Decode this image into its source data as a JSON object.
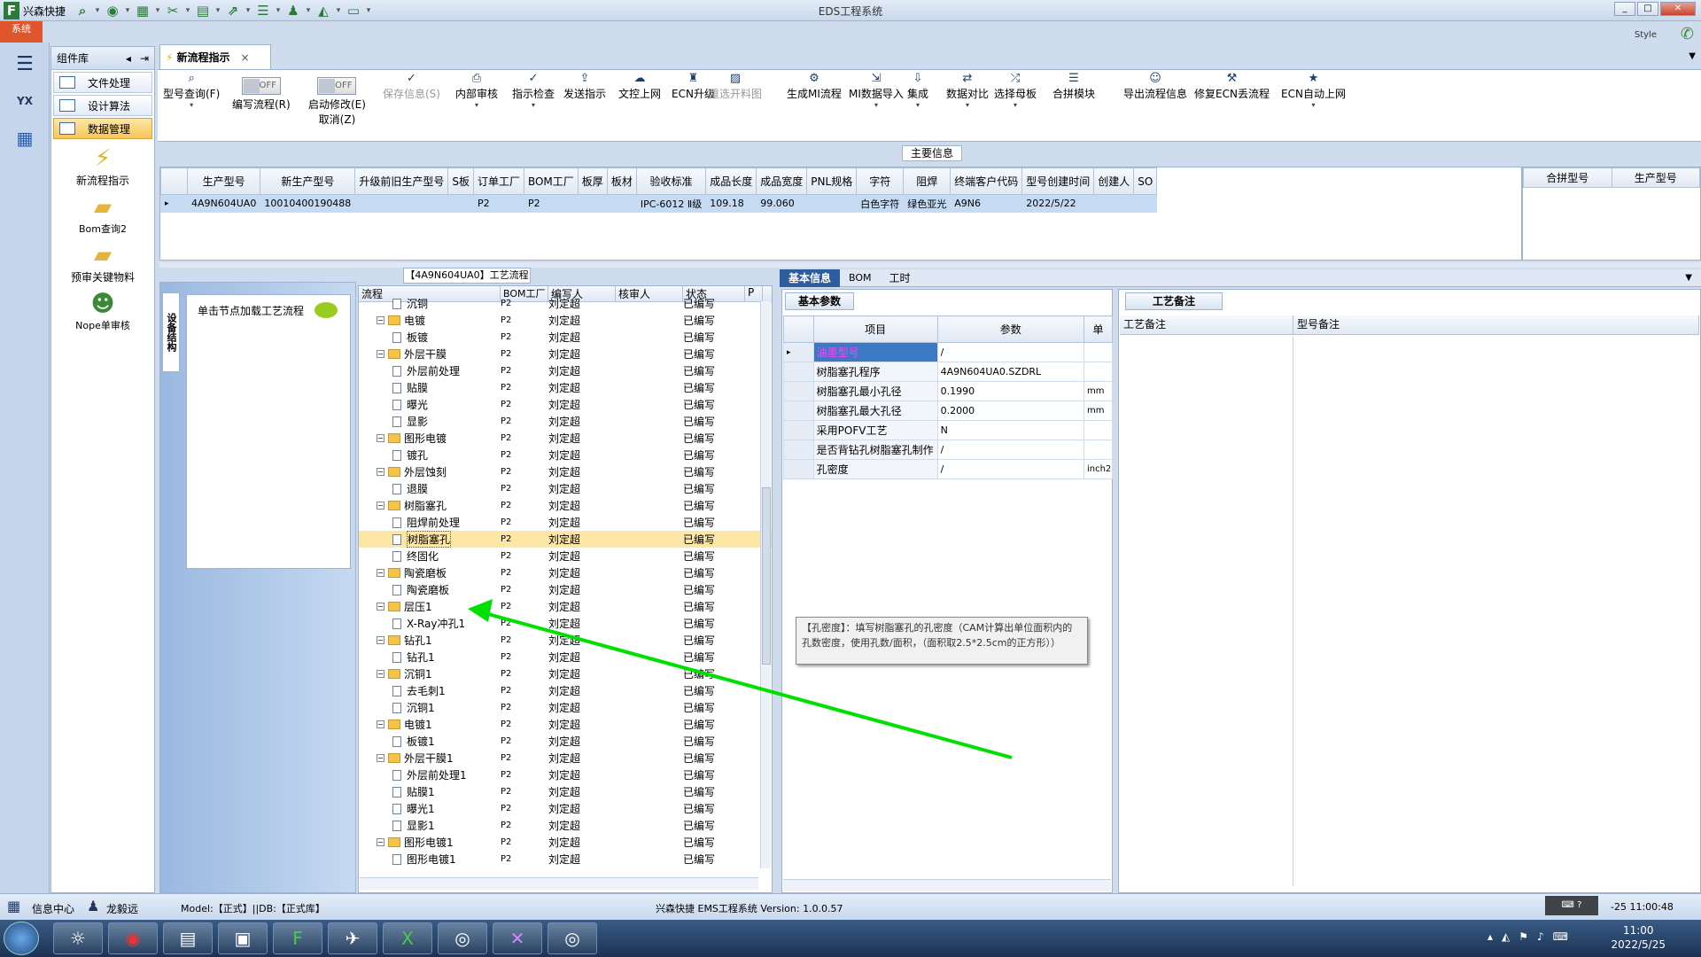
{
  "window": {
    "title": "EDS工程系统",
    "app_name": "兴森快捷",
    "system_tab": "系统",
    "style_label": "Style"
  },
  "component_panel": {
    "title": "组件库",
    "menus": [
      {
        "label": "文件处理",
        "active": false
      },
      {
        "label": "设计算法",
        "active": false
      },
      {
        "label": "数据管理",
        "active": true
      }
    ],
    "items": [
      {
        "label": "新流程指示",
        "icon": "lightning-icon"
      },
      {
        "label": "Bom查询2",
        "icon": "folder-icon"
      },
      {
        "label": "预审关键物料",
        "icon": "folder-icon"
      },
      {
        "label": "Nope单审核",
        "icon": "user-icon"
      }
    ]
  },
  "doc_tab": {
    "label": "新流程指示",
    "close": "×"
  },
  "ribbon": {
    "buttons": [
      {
        "label": "型号查询(F)",
        "icon": "search-icon",
        "disabled": false,
        "dropdown": true
      },
      {
        "label": "编写流程(R)",
        "toggle": "OFF",
        "disabled": false
      },
      {
        "label": "启动修改(E)",
        "sublabel": "取消(Z)",
        "toggle": "OFF",
        "disabled": false
      },
      {
        "label": "保存信息(S)",
        "icon": "check-icon",
        "disabled": true
      },
      {
        "label": "内部审核",
        "icon": "print-icon",
        "disabled": false,
        "dropdown": true
      },
      {
        "label": "指示检查",
        "icon": "check-icon",
        "disabled": false,
        "dropdown": true
      },
      {
        "label": "发送指示",
        "icon": "upload-icon",
        "disabled": false
      },
      {
        "label": "文控上网",
        "icon": "cloud-icon",
        "disabled": false
      },
      {
        "label": "ECN升级",
        "icon": "ecn-icon",
        "disabled": false
      },
      {
        "label": "重选开料图",
        "icon": "image-icon",
        "disabled": true
      },
      {
        "label": "生成MI流程",
        "icon": "gears-icon",
        "disabled": false
      },
      {
        "label": "MI数据导入",
        "icon": "import-icon",
        "disabled": false,
        "dropdown": true
      },
      {
        "label": "集成",
        "icon": "download-icon",
        "disabled": false,
        "dropdown": true
      },
      {
        "label": "数据对比",
        "icon": "compare-icon",
        "disabled": false,
        "dropdown": true
      },
      {
        "label": "选择母板",
        "icon": "shuffle-icon",
        "disabled": false,
        "dropdown": true
      },
      {
        "label": "合拼模块",
        "icon": "list-icon",
        "disabled": false
      },
      {
        "label": "导出流程信息",
        "icon": "smile-icon",
        "disabled": false
      },
      {
        "label": "修复ECN丢流程",
        "icon": "wrench-icon",
        "disabled": false
      },
      {
        "label": "ECN自动上网",
        "icon": "star-icon",
        "disabled": false,
        "dropdown": true
      }
    ]
  },
  "main_info": {
    "label": "主要信息",
    "columns": [
      "生产型号",
      "新生产型号",
      "升级前旧生产型号",
      "S板",
      "订单工厂",
      "BOM工厂",
      "板厚",
      "板材",
      "验收标准",
      "成品长度",
      "成品宽度",
      "PNL规格",
      "字符",
      "阻焊",
      "终端客户代码",
      "型号创建时间",
      "创建人",
      "SO"
    ],
    "rows": [
      [
        "4A9N604UA0",
        "10010400190488",
        "",
        "",
        "P2",
        "P2",
        "",
        "",
        "IPC-6012 Ⅱ级",
        "109.18",
        "99.060",
        "",
        "白色字符",
        "绿色亚光",
        "A9N6",
        "2022/5/22",
        "",
        ""
      ]
    ],
    "side_columns": [
      "合拼型号",
      "生产型号"
    ]
  },
  "equipment": {
    "tab": "设备结构",
    "message": "单击节点加载工艺流程"
  },
  "flow": {
    "title": "【4A9N604UA0】工艺流程",
    "columns": [
      "流程",
      "BOM工厂",
      "编写人",
      "核审人",
      "状态",
      "P"
    ],
    "rows": [
      {
        "name": "沉铜",
        "level": 1,
        "folder": false,
        "bom": "P2",
        "writer": "刘定超",
        "status": "已编写"
      },
      {
        "name": "电镀",
        "level": 0,
        "folder": true,
        "bom": "P2",
        "writer": "刘定超",
        "status": "已编写"
      },
      {
        "name": "板镀",
        "level": 1,
        "folder": false,
        "bom": "P2",
        "writer": "刘定超",
        "status": "已编写"
      },
      {
        "name": "外层干膜",
        "level": 0,
        "folder": true,
        "bom": "P2",
        "writer": "刘定超",
        "status": "已编写"
      },
      {
        "name": "外层前处理",
        "level": 1,
        "folder": false,
        "bom": "P2",
        "writer": "刘定超",
        "status": "已编写"
      },
      {
        "name": "贴膜",
        "level": 1,
        "folder": false,
        "bom": "P2",
        "writer": "刘定超",
        "status": "已编写"
      },
      {
        "name": "曝光",
        "level": 1,
        "folder": false,
        "bom": "P2",
        "writer": "刘定超",
        "status": "已编写"
      },
      {
        "name": "显影",
        "level": 1,
        "folder": false,
        "bom": "P2",
        "writer": "刘定超",
        "status": "已编写"
      },
      {
        "name": "图形电镀",
        "level": 0,
        "folder": true,
        "bom": "P2",
        "writer": "刘定超",
        "status": "已编写"
      },
      {
        "name": "镀孔",
        "level": 1,
        "folder": false,
        "bom": "P2",
        "writer": "刘定超",
        "status": "已编写"
      },
      {
        "name": "外层蚀刻",
        "level": 0,
        "folder": true,
        "bom": "P2",
        "writer": "刘定超",
        "status": "已编写"
      },
      {
        "name": "退膜",
        "level": 1,
        "folder": false,
        "bom": "P2",
        "writer": "刘定超",
        "status": "已编写"
      },
      {
        "name": "树脂塞孔",
        "level": 0,
        "folder": true,
        "bom": "P2",
        "writer": "刘定超",
        "status": "已编写"
      },
      {
        "name": "阻焊前处理",
        "level": 1,
        "folder": false,
        "bom": "P2",
        "writer": "刘定超",
        "status": "已编写"
      },
      {
        "name": "树脂塞孔",
        "level": 1,
        "folder": false,
        "bom": "P2",
        "writer": "刘定超",
        "status": "已编写",
        "selected": true
      },
      {
        "name": "终固化",
        "level": 1,
        "folder": false,
        "bom": "P2",
        "writer": "刘定超",
        "status": "已编写"
      },
      {
        "name": "陶瓷磨板",
        "level": 0,
        "folder": true,
        "bom": "P2",
        "writer": "刘定超",
        "status": "已编写"
      },
      {
        "name": "陶瓷磨板",
        "level": 1,
        "folder": false,
        "bom": "P2",
        "writer": "刘定超",
        "status": "已编写"
      },
      {
        "name": "层压1",
        "level": 0,
        "folder": true,
        "bom": "P2",
        "writer": "刘定超",
        "status": "已编写"
      },
      {
        "name": "X-Ray冲孔1",
        "level": 1,
        "folder": false,
        "bom": "P2",
        "writer": "刘定超",
        "status": "已编写"
      },
      {
        "name": "钻孔1",
        "level": 0,
        "folder": true,
        "bom": "P2",
        "writer": "刘定超",
        "status": "已编写"
      },
      {
        "name": "钻孔1",
        "level": 1,
        "folder": false,
        "bom": "P2",
        "writer": "刘定超",
        "status": "已编写"
      },
      {
        "name": "沉铜1",
        "level": 0,
        "folder": true,
        "bom": "P2",
        "writer": "刘定超",
        "status": "已编写"
      },
      {
        "name": "去毛刺1",
        "level": 1,
        "folder": false,
        "bom": "P2",
        "writer": "刘定超",
        "status": "已编写"
      },
      {
        "name": "沉铜1",
        "level": 1,
        "folder": false,
        "bom": "P2",
        "writer": "刘定超",
        "status": "已编写"
      },
      {
        "name": "电镀1",
        "level": 0,
        "folder": true,
        "bom": "P2",
        "writer": "刘定超",
        "status": "已编写"
      },
      {
        "name": "板镀1",
        "level": 1,
        "folder": false,
        "bom": "P2",
        "writer": "刘定超",
        "status": "已编写"
      },
      {
        "name": "外层干膜1",
        "level": 0,
        "folder": true,
        "bom": "P2",
        "writer": "刘定超",
        "status": "已编写"
      },
      {
        "name": "外层前处理1",
        "level": 1,
        "folder": false,
        "bom": "P2",
        "writer": "刘定超",
        "status": "已编写"
      },
      {
        "name": "贴膜1",
        "level": 1,
        "folder": false,
        "bom": "P2",
        "writer": "刘定超",
        "status": "已编写"
      },
      {
        "name": "曝光1",
        "level": 1,
        "folder": false,
        "bom": "P2",
        "writer": "刘定超",
        "status": "已编写"
      },
      {
        "name": "显影1",
        "level": 1,
        "folder": false,
        "bom": "P2",
        "writer": "刘定超",
        "status": "已编写"
      },
      {
        "name": "图形电镀1",
        "level": 0,
        "folder": true,
        "bom": "P2",
        "writer": "刘定超",
        "status": "已编写"
      },
      {
        "name": "图形电镀1",
        "level": 1,
        "folder": false,
        "bom": "P2",
        "writer": "刘定超",
        "status": "已编写"
      }
    ]
  },
  "right_tabs": [
    "基本信息",
    "BOM",
    "工时"
  ],
  "basic_params": {
    "subtab": "基本参数",
    "columns": [
      "项目",
      "参数",
      "单"
    ],
    "rows": [
      {
        "name": "油墨型号",
        "value": "/",
        "unit": "",
        "highlight": true
      },
      {
        "name": "树脂塞孔程序",
        "value": "4A9N604UA0.SZDRL",
        "unit": ""
      },
      {
        "name": "树脂塞孔最小孔径",
        "value": "0.1990",
        "unit": "mm"
      },
      {
        "name": "树脂塞孔最大孔径",
        "value": "0.2000",
        "unit": "mm"
      },
      {
        "name": "采用POFV工艺",
        "value": "N",
        "unit": ""
      },
      {
        "name": "是否背钻孔树脂塞孔制作",
        "value": "/",
        "unit": ""
      },
      {
        "name": "孔密度",
        "value": "/",
        "unit": "inch2"
      }
    ],
    "tooltip": "【孔密度】：填写树脂塞孔的孔密度（CAM计算出单位面积内的孔数密度，使用孔数/面积，（面积取2.5*2.5cm的正方形））"
  },
  "remarks": {
    "subtab": "工艺备注",
    "columns": [
      "工艺备注",
      "型号备注"
    ]
  },
  "status_bar": {
    "info_center": "信息中心",
    "user": "龙毅远",
    "model": "Model:【正式】||DB:【正式库】",
    "version": "兴森快捷 EMS工程系统 Version: 1.0.0.57",
    "datetime": "-25 11:00:48"
  },
  "taskbar": {
    "time": "11:00",
    "date": "2022/5/25"
  }
}
